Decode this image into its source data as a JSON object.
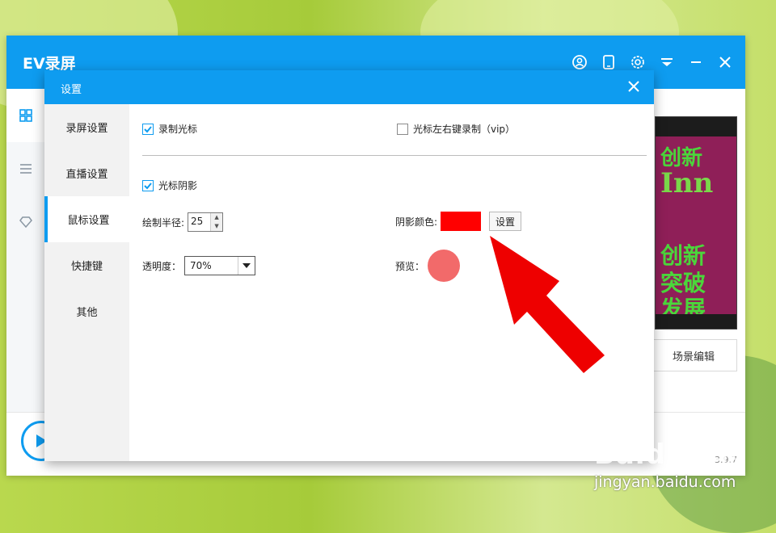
{
  "app": {
    "title": "EV录屏",
    "version": "3.9.7"
  },
  "title_bar_icons": [
    "user-circle-icon",
    "phone-icon",
    "gear-icon",
    "menu-icon",
    "minimize-icon",
    "close-icon"
  ],
  "main": {
    "scene_edit_label": "场景编辑"
  },
  "dialog": {
    "title": "设置",
    "sidebar": [
      {
        "label": "录屏设置",
        "active": false
      },
      {
        "label": "直播设置",
        "active": false
      },
      {
        "label": "鼠标设置",
        "active": true
      },
      {
        "label": "快捷键",
        "active": false
      },
      {
        "label": "其他",
        "active": false
      }
    ],
    "mouse": {
      "record_cursor_label": "录制光标",
      "record_cursor_checked": true,
      "record_lr_click_label": "光标左右键录制（vip）",
      "record_lr_click_checked": false,
      "cursor_shadow_label": "光标阴影",
      "cursor_shadow_checked": true,
      "radius_label": "绘制半径:",
      "radius_value": "25",
      "shadow_color_label": "阴影颜色:",
      "shadow_color": "#ff0000",
      "set_button_label": "设置",
      "opacity_label": "透明度：",
      "opacity_value": "70%",
      "preview_label": "预览：",
      "preview_color": "#f26a6a"
    }
  },
  "watermark": {
    "logo": "Baidu经验",
    "url": "jingyan.baidu.com"
  },
  "colors": {
    "accent": "#0e9cf0",
    "arrow": "#ee0000"
  }
}
